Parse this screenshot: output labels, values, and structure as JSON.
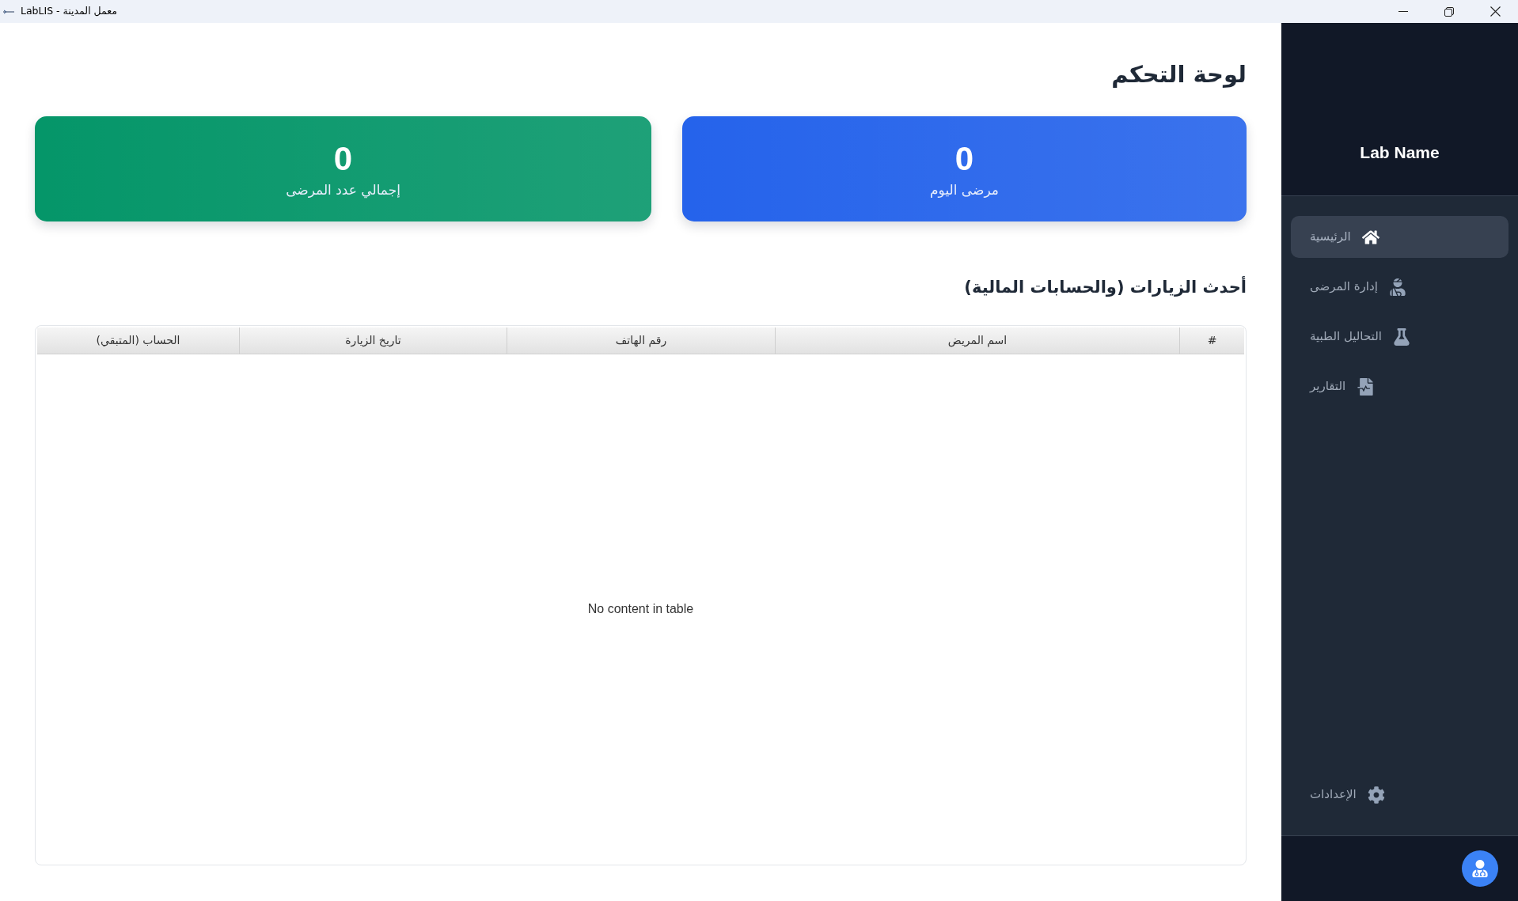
{
  "window": {
    "title": "LabLIS - معمل المدينة"
  },
  "page": {
    "title": "لوحة التحكم"
  },
  "stats": [
    {
      "value": "0",
      "label": "مرضى اليوم",
      "color": "#2563eb"
    },
    {
      "value": "0",
      "label": "إجمالي عدد المرضى",
      "color": "#059669"
    }
  ],
  "visits_table": {
    "title": "أحدث الزيارات (والحسابات المالية)",
    "columns": [
      "#",
      "اسم المريض",
      "رقم الهاتف",
      "تاريخ الزيارة",
      "الحساب (المتبقي)"
    ],
    "empty_message": "No content in table"
  },
  "sidebar": {
    "brand": "Lab Name",
    "items": [
      {
        "kind": "home",
        "label": "الرئيسية",
        "selected": true
      },
      {
        "kind": "patients",
        "label": "إدارة المرضى",
        "selected": false
      },
      {
        "kind": "tests",
        "label": "التحاليل الطبية",
        "selected": false
      },
      {
        "kind": "reports",
        "label": "التقارير",
        "selected": false
      }
    ],
    "footer_items": [
      {
        "kind": "settings",
        "label": "الإعدادات",
        "selected": false
      }
    ]
  }
}
